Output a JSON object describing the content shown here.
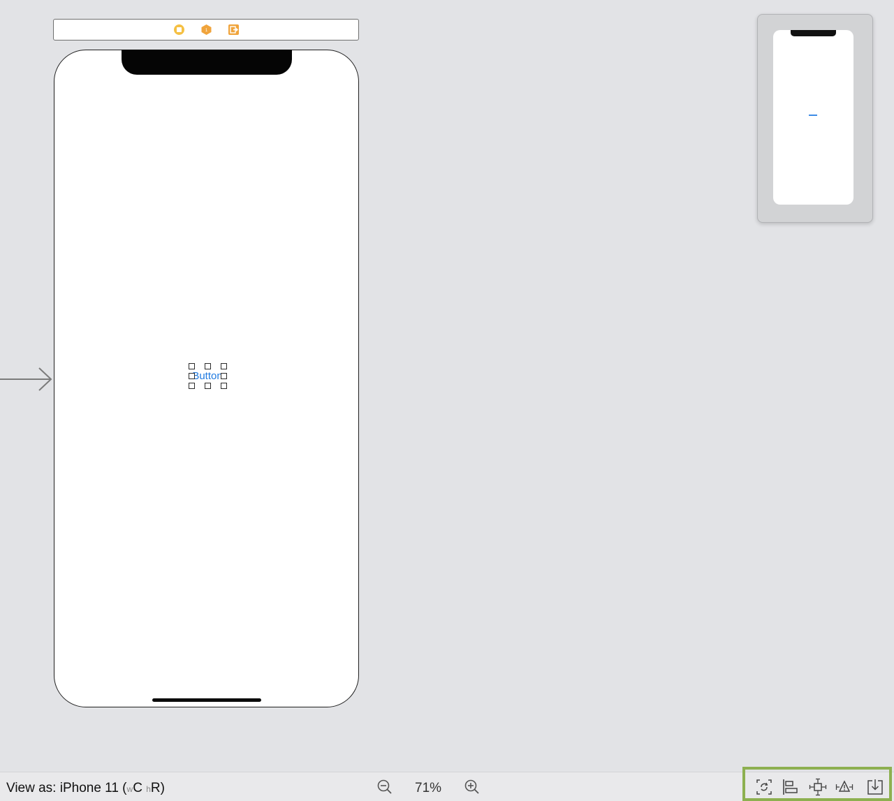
{
  "scene_dock": {
    "icons": [
      "view-controller-icon",
      "first-responder-icon",
      "exit-icon"
    ]
  },
  "canvas": {
    "device": "iPhone 11",
    "selected_button_label": "Button"
  },
  "bottom_bar": {
    "view_as_prefix": "View as: iPhone 11 (",
    "width_small": "w",
    "width_class": "C",
    "height_small": "h",
    "height_class": "R",
    "suffix": ")",
    "zoom": "71%"
  },
  "tools": [
    "update-frames-icon",
    "align-icon",
    "add-constraints-icon",
    "resolve-issues-icon",
    "embed-in-icon"
  ],
  "colors": {
    "canvas_bg": "#e2e3e6",
    "accent": "#1f7ae0",
    "highlight": "#8db050"
  }
}
